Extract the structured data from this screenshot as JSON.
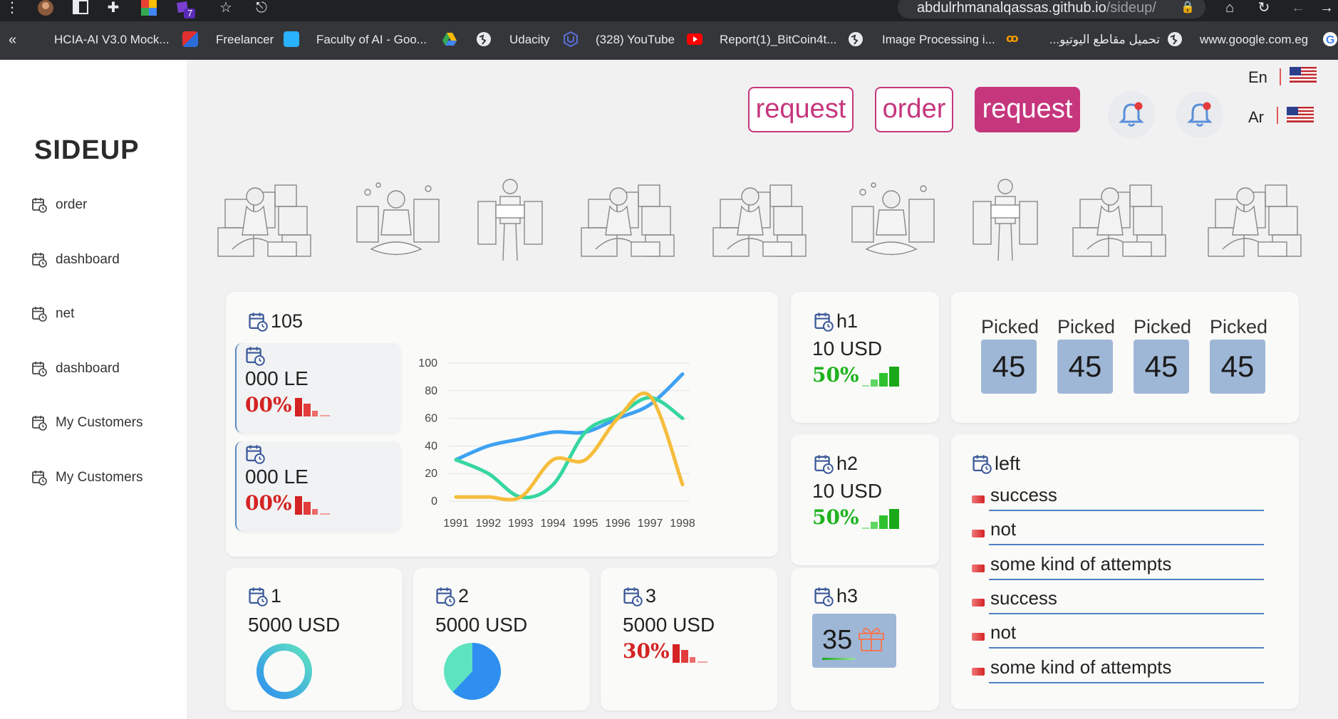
{
  "browser": {
    "url_host": "abdulrhmanalqassas.github.io",
    "url_path": "/sideup/",
    "extension_badge": "7",
    "bookmarks": [
      {
        "label": "HCIA-AI V3.0 Mock...",
        "icon": "ext-icon"
      },
      {
        "label": "Freelancer",
        "icon": "freelancer-icon"
      },
      {
        "label": "Faculty of AI - Goo...",
        "icon": "drive-icon"
      },
      {
        "label": "Udacity",
        "icon": "udacity-icon"
      },
      {
        "label": "(328) YouTube",
        "icon": "youtube-icon"
      },
      {
        "label": "Report(1)_BitCoin4t...",
        "icon": "web-icon"
      },
      {
        "label": "Image Processing i...",
        "icon": "cc-icon"
      },
      {
        "label": "تحميل مقاطع اليوتيو...",
        "icon": "web-icon"
      },
      {
        "label": "www.google.com.eg",
        "icon": "google-icon"
      }
    ]
  },
  "sidebar": {
    "logo": "SIDEUP",
    "items": [
      {
        "label": "order"
      },
      {
        "label": "dashboard"
      },
      {
        "label": "net"
      },
      {
        "label": "dashboard"
      },
      {
        "label": "My Customers"
      },
      {
        "label": "My Customers"
      }
    ]
  },
  "header": {
    "buttons": [
      "request",
      "order",
      "request"
    ],
    "lang_en": "En",
    "lang_ar": "Ar"
  },
  "overview_card": {
    "title": "105",
    "stat1_value": "000 LE",
    "stat1_pct": "00%",
    "stat2_value": "000 LE",
    "stat2_pct": "00%"
  },
  "chart_data": {
    "type": "line",
    "x": [
      1991,
      1992,
      1993,
      1994,
      1995,
      1996,
      1997,
      1998
    ],
    "ylim": [
      0,
      100
    ],
    "yticks": [
      0,
      20,
      40,
      60,
      80,
      100
    ],
    "series": [
      {
        "color": "#3ea1f2",
        "values": [
          30,
          40,
          45,
          50,
          50,
          60,
          70,
          92
        ]
      },
      {
        "color": "#36d6a0",
        "values": [
          30,
          20,
          3,
          12,
          50,
          62,
          75,
          60
        ]
      },
      {
        "color": "#f6bd3c",
        "values": [
          3,
          3,
          3,
          30,
          30,
          60,
          76,
          12
        ]
      }
    ]
  },
  "h_cards": [
    {
      "title": "h1",
      "value": "10 USD",
      "pct": "50%"
    },
    {
      "title": "h2",
      "value": "10 USD",
      "pct": "50%"
    }
  ],
  "h3_card": {
    "title": "h3",
    "value": "35"
  },
  "picked": [
    {
      "label": "Picked",
      "value": "45"
    },
    {
      "label": "Picked",
      "value": "45"
    },
    {
      "label": "Picked",
      "value": "45"
    },
    {
      "label": "Picked",
      "value": "45"
    }
  ],
  "left_card": {
    "title": "left",
    "items": [
      "success",
      "not",
      "some kind of attempts",
      "success",
      "not",
      "some kind of attempts"
    ]
  },
  "small_cards": [
    {
      "title": "1",
      "value": "5000 USD",
      "ring_fraction": 1.0
    },
    {
      "title": "2",
      "value": "5000 USD",
      "pie_fraction": 0.62
    },
    {
      "title": "3",
      "value": "5000 USD",
      "pct": "30%"
    }
  ],
  "colors": {
    "accent": "#c6367d",
    "negative": "#d42323",
    "positive": "#1fb31f",
    "tile": "#9fb7d6"
  }
}
